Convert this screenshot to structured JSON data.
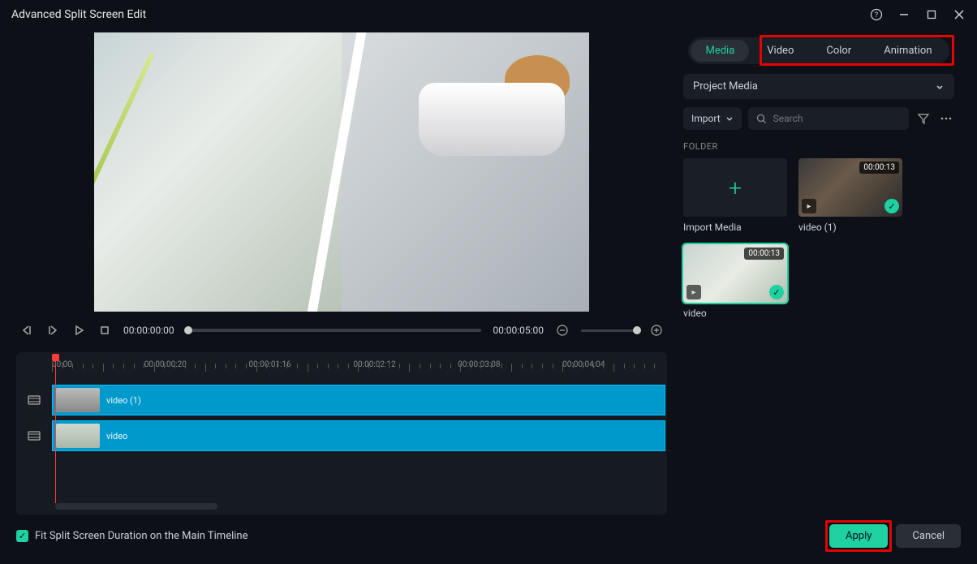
{
  "titlebar": {
    "title": "Advanced Split Screen Edit"
  },
  "preview": {
    "current_time": "00:00:00:00",
    "end_time": "00:00:05:00"
  },
  "timeline": {
    "marks": [
      {
        "label": "00:00",
        "pos": 0
      },
      {
        "label": "00:00:00:20",
        "pos": 15
      },
      {
        "label": "00:00:01:16",
        "pos": 32
      },
      {
        "label": "00:00:02:12",
        "pos": 49
      },
      {
        "label": "00:00:03:08",
        "pos": 66
      },
      {
        "label": "00:00:04:04",
        "pos": 83
      }
    ],
    "tracks": [
      {
        "clip_label": "video (1)"
      },
      {
        "clip_label": "video"
      }
    ]
  },
  "right": {
    "tabs": {
      "t0": "Media",
      "t1": "Video",
      "t2": "Color",
      "t3": "Animation"
    },
    "project_dropdown": "Project Media",
    "import_label": "Import",
    "search_placeholder": "Search",
    "folder_label": "FOLDER",
    "items": {
      "import": "Import Media",
      "v1_name": "video (1)",
      "v1_dur": "00:00:13",
      "v2_name": "video",
      "v2_dur": "00:00:13"
    }
  },
  "footer": {
    "fit_label": "Fit Split Screen Duration on the Main Timeline",
    "apply": "Apply",
    "cancel": "Cancel"
  }
}
